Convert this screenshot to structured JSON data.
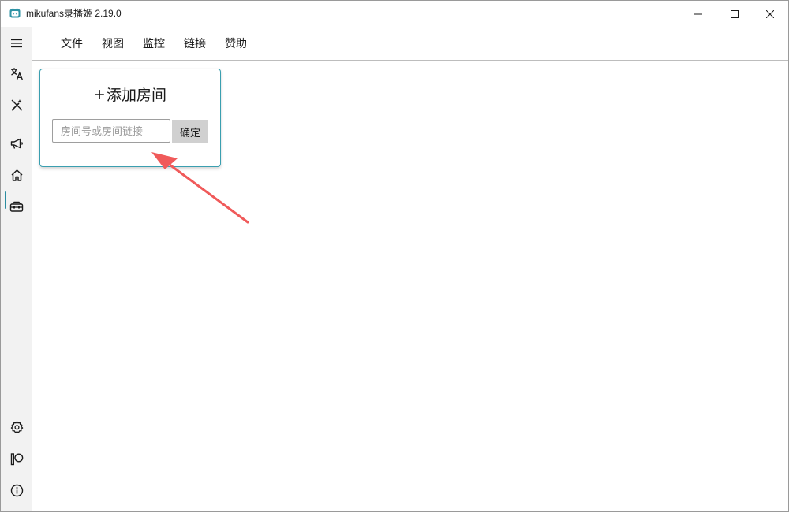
{
  "window": {
    "title": "mikufans录播姬 2.19.0",
    "controls": [
      "minimize-icon",
      "maximize-icon",
      "close-icon"
    ]
  },
  "sidebar": {
    "items": [
      {
        "icon": "hamburger-menu-icon"
      },
      {
        "icon": "translate-icon"
      },
      {
        "icon": "magic-wand-off-icon"
      },
      {
        "icon": "megaphone-icon"
      },
      {
        "icon": "home-icon",
        "active": true
      },
      {
        "icon": "toolbox-icon"
      },
      {
        "icon": "settings-gear-icon"
      },
      {
        "icon": "patreon-icon"
      },
      {
        "icon": "info-icon"
      }
    ],
    "accent_color": "#2a8ca0"
  },
  "menu": {
    "items": [
      {
        "label": "文件"
      },
      {
        "label": "视图"
      },
      {
        "label": "监控"
      },
      {
        "label": "链接"
      },
      {
        "label": "赞助"
      }
    ]
  },
  "add_room_card": {
    "plus": "+",
    "title": "添加房间",
    "input_placeholder": "房间号或房间链接",
    "input_value": "",
    "confirm_label": "确定",
    "border_color": "#3a9fb0"
  },
  "annotation": {
    "arrow_color": "#f05a5a"
  }
}
